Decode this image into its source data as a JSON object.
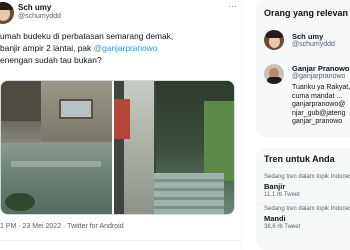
{
  "tweet": {
    "author_name": "Sch umy",
    "author_handle": "@schumyddd",
    "more_icon": "more-dots-icon",
    "text_lines": [
      {
        "pre": "umah budeku di perbatasan semarang demak,",
        "mention": "",
        "post": ""
      },
      {
        "pre": "banjir ampir 2 lantai, pak ",
        "mention": "@ganjarpranowo",
        "post": ""
      },
      {
        "pre": "enengan sudah tau bukan?",
        "mention": "",
        "post": ""
      }
    ],
    "meta": "1 PM · 23 Mei 2022 · Twitter for Android"
  },
  "sidebar": {
    "who_to_follow": {
      "title": "Orang yang relevan",
      "users": [
        {
          "name": "Sch umy",
          "handle": "@schumyddd"
        },
        {
          "name": "Ganjar Pranowo",
          "handle": "@ganjarpranowo",
          "bio_lines": [
            "Tuanku ya Rakyat,",
            "cuma mandat ...",
            "ganjarpranowo@",
            "njar_gub@jateng",
            "ganjar_pranowo"
          ]
        }
      ]
    },
    "trends": {
      "title": "Tren untuk Anda",
      "items": [
        {
          "context": "Sedang tren dalam topik Indonesia",
          "name": "Banjir",
          "count": "11,1 rb Tweet"
        },
        {
          "context": "Sedang tren dalam topik Indonesia",
          "name": "Mandi",
          "count": "38,6 rb Tweet"
        }
      ]
    }
  },
  "colors": {
    "link": "#1d9bf0",
    "text": "#0f1419",
    "secondary": "#536471",
    "card_bg": "#f7f9f9"
  }
}
